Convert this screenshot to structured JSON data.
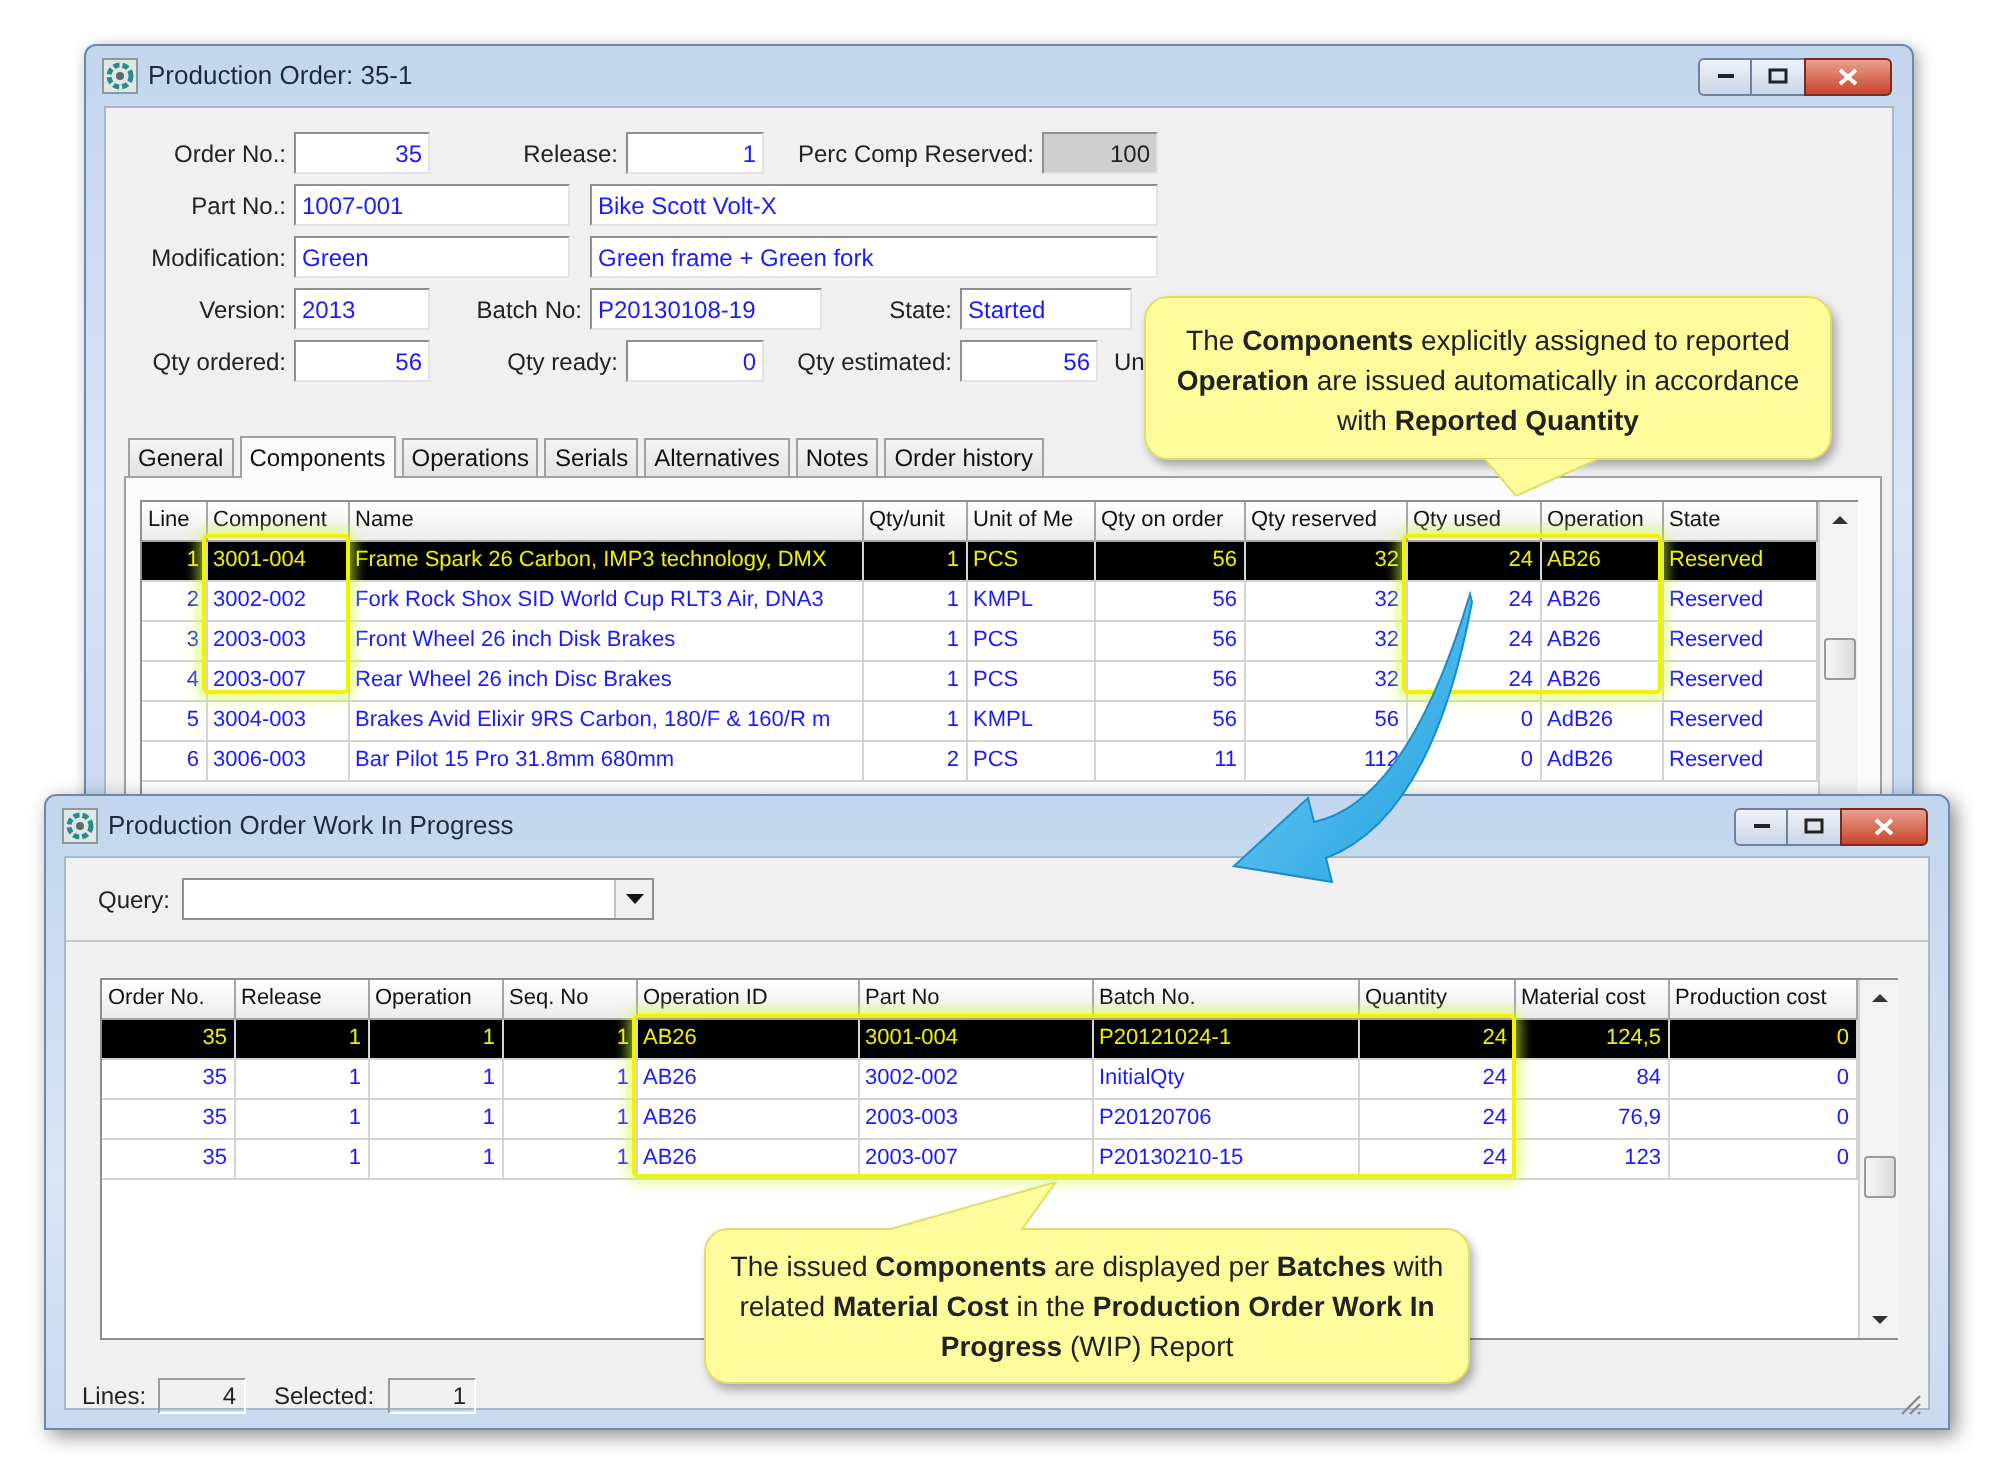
{
  "order_window": {
    "title": "Production Order: 35-1",
    "form_rows": [
      [
        {
          "label": "Order No.:",
          "value": "35",
          "kind": "number",
          "read_only": false
        },
        {
          "label": "Release:",
          "value": "1",
          "kind": "number",
          "read_only": false
        },
        {
          "label": "Perc Comp Reserved:",
          "value": "100",
          "kind": "number",
          "read_only": true
        }
      ],
      [
        {
          "label": "Part No.:",
          "value": "1007-001",
          "kind": "text",
          "read_only": false
        },
        {
          "value": "Bike Scott Volt-X",
          "kind": "text",
          "read_only": false
        }
      ],
      [
        {
          "label": "Modification:",
          "value": "Green",
          "kind": "text",
          "read_only": false
        },
        {
          "value": "Green frame + Green fork",
          "kind": "text",
          "read_only": false
        }
      ],
      [
        {
          "label": "Version:",
          "value": "2013",
          "kind": "text",
          "read_only": false
        },
        {
          "label": "Batch No:",
          "value": "P20130108-19",
          "kind": "text",
          "read_only": false
        },
        {
          "label": "State:",
          "value": "Started",
          "kind": "text",
          "read_only": false
        }
      ],
      [
        {
          "label": "Qty ordered:",
          "value": "56",
          "kind": "number",
          "read_only": false
        },
        {
          "label": "Qty ready:",
          "value": "0",
          "kind": "number",
          "read_only": false
        },
        {
          "label": "Qty estimated:",
          "value": "56",
          "kind": "number",
          "read_only": false
        },
        {
          "label": "Un",
          "kind": "label"
        }
      ]
    ],
    "tabs": [
      {
        "label": "General",
        "selected": false
      },
      {
        "label": "Components",
        "selected": true
      },
      {
        "label": "Operations",
        "selected": false
      },
      {
        "label": "Serials",
        "selected": false
      },
      {
        "label": "Alternatives",
        "selected": false
      },
      {
        "label": "Notes",
        "selected": false
      },
      {
        "label": "Order history",
        "selected": false
      }
    ],
    "table": {
      "columns": [
        "Line",
        "Component",
        "Name",
        "Qty/unit",
        "Unit of Me",
        "Qty on order",
        "Qty reserved",
        "Qty used",
        "Operation",
        "State"
      ],
      "rows": [
        {
          "selected": true,
          "cells": [
            "1",
            "3001-004",
            "Frame Spark 26 Carbon, IMP3 technology, DMX",
            "1",
            "PCS",
            "56",
            "32",
            "24",
            "AB26",
            "Reserved"
          ]
        },
        {
          "selected": false,
          "cells": [
            "2",
            "3002-002",
            "Fork Rock Shox SID World Cup RLT3 Air, DNA3",
            "1",
            "KMPL",
            "56",
            "32",
            "24",
            "AB26",
            "Reserved"
          ]
        },
        {
          "selected": false,
          "cells": [
            "3",
            "2003-003",
            "Front Wheel 26 inch Disk Brakes",
            "1",
            "PCS",
            "56",
            "32",
            "24",
            "AB26",
            "Reserved"
          ]
        },
        {
          "selected": false,
          "cells": [
            "4",
            "2003-007",
            "Rear Wheel 26 inch Disc Brakes",
            "1",
            "PCS",
            "56",
            "32",
            "24",
            "AB26",
            "Reserved"
          ]
        },
        {
          "selected": false,
          "cells": [
            "5",
            "3004-003",
            "Brakes Avid Elixir 9RS Carbon, 180/F & 160/R m",
            "1",
            "KMPL",
            "56",
            "56",
            "0",
            "AdB26",
            "Reserved"
          ]
        },
        {
          "selected": false,
          "cells": [
            "6",
            "3006-003",
            "Bar Pilot 15 Pro 31.8mm 680mm",
            "2",
            "PCS",
            "11",
            "112",
            "0",
            "AdB26",
            "Reserved"
          ]
        }
      ]
    }
  },
  "wip_window": {
    "title": "Production Order Work In Progress",
    "query": {
      "label": "Query:"
    },
    "table": {
      "columns": [
        "Order No.",
        "Release",
        "Operation",
        "Seq. No",
        "Operation ID",
        "Part No",
        "Batch No.",
        "Quantity",
        "Material cost",
        "Production cost"
      ],
      "rows": [
        {
          "selected": true,
          "cells": [
            "35",
            "1",
            "1",
            "1",
            "AB26",
            "3001-004",
            "P20121024-1",
            "24",
            "124,5",
            "0"
          ]
        },
        {
          "selected": false,
          "cells": [
            "35",
            "1",
            "1",
            "1",
            "AB26",
            "3002-002",
            "InitialQty",
            "24",
            "84",
            "0"
          ]
        },
        {
          "selected": false,
          "cells": [
            "35",
            "1",
            "1",
            "1",
            "AB26",
            "2003-003",
            "P20120706",
            "24",
            "76,9",
            "0"
          ]
        },
        {
          "selected": false,
          "cells": [
            "35",
            "1",
            "1",
            "1",
            "AB26",
            "2003-007",
            "P20130210-15",
            "24",
            "123",
            "0"
          ]
        }
      ]
    },
    "status": [
      {
        "label": "Lines:",
        "value": "4"
      },
      {
        "label": "Selected:",
        "value": "1"
      }
    ]
  },
  "callouts": [
    {
      "text": "The **Components** explicitly assigned to reported **Operation** are issued automatically in accordance with **Reported Quantity**"
    },
    {
      "text": "The issued **Components** are displayed per **Batches** with related **Material Cost** in the **Production  Order Work In Progress** (WIP) Report"
    }
  ]
}
